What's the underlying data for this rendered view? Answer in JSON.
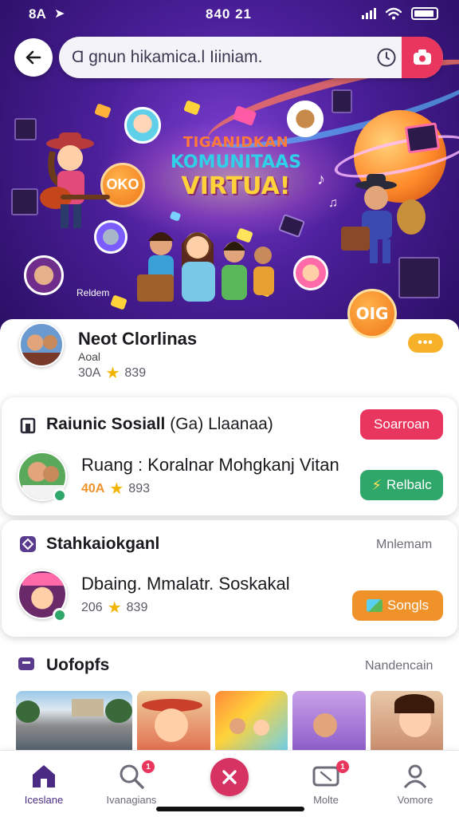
{
  "status_bar": {
    "time_left": "8A",
    "time_center": "840 21"
  },
  "search": {
    "query": "Ɑ ɡnun hikamica.l Iiiniam."
  },
  "hero": {
    "title_line1": "TIGANIDKAN",
    "title_line2": "KOMUNITAAS",
    "title_line3": "VIRTUA!",
    "caption": "Reldem",
    "coin_text": "OIG",
    "badge_text": "OKO"
  },
  "profile": {
    "name": "Neot Clorlinas",
    "subtitle": "Aoal",
    "stat_left": "30A",
    "stat_right": "839"
  },
  "social": {
    "title": "Raiunic Sosiall",
    "title_suffix": "(Ga) Llaanaa)",
    "action_label": "Soarroan",
    "row_text": "Ruang : Koralnar Mohgkanj Vitan",
    "stat_left": "40A",
    "stat_right": "893",
    "secondary_label": "Relbalc"
  },
  "stats_section": {
    "title": "Stahkaiokganl",
    "link_label": "Mnlemam",
    "row_text": "Dbaing. Mmalatr. Soskakal",
    "stat_left": "206",
    "stat_right": "839",
    "action_label": "Songls"
  },
  "updates": {
    "title": "Uofopfs",
    "link_label": "Nandencain"
  },
  "nav": {
    "items": [
      {
        "label": "Iceslane",
        "icon": "home-icon"
      },
      {
        "label": "Ivanagians",
        "icon": "search-icon",
        "badge": "1"
      },
      {
        "label": "",
        "icon": "close-icon"
      },
      {
        "label": "Molte",
        "icon": "tv-icon",
        "badge": "1"
      },
      {
        "label": "Vomore",
        "icon": "profile-icon"
      }
    ]
  },
  "colors": {
    "accent_red": "#e8365f",
    "accent_green": "#2fa66a",
    "accent_orange": "#f0922a",
    "accent_yellow": "#f6b128",
    "brand_purple": "#4b1f9a"
  }
}
